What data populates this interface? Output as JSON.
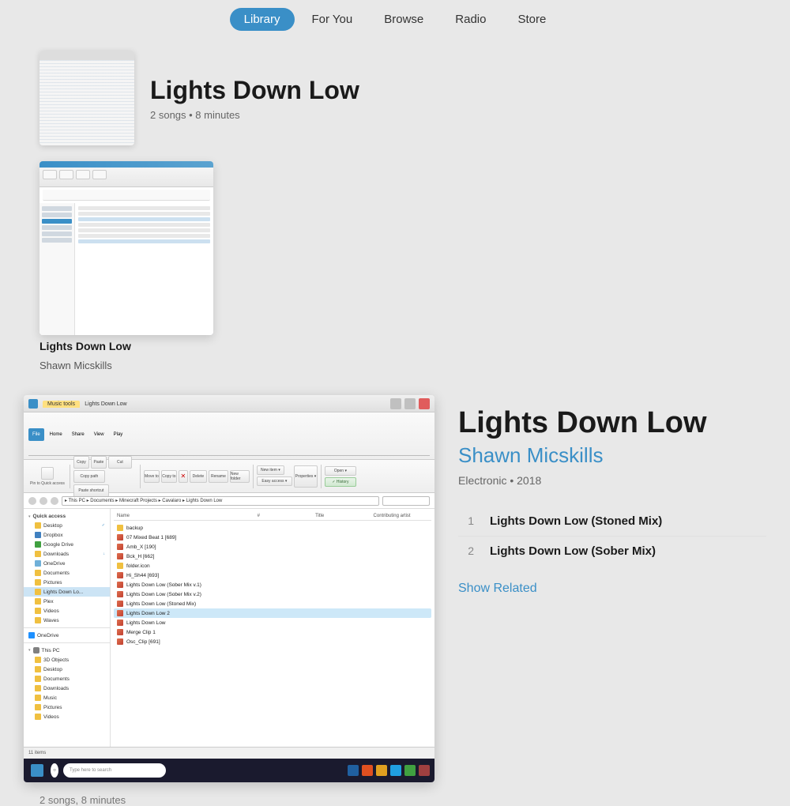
{
  "nav": {
    "items": [
      "Library",
      "For You",
      "Browse",
      "Radio",
      "Store"
    ],
    "active": "Library"
  },
  "hero": {
    "title": "Lights Down Low",
    "songs_count": "2 songs",
    "duration": "8 minutes",
    "meta": "2 songs • 8 minutes"
  },
  "album_card": {
    "name": "Lights Down Low",
    "artist": "Shawn Micskills"
  },
  "right_panel": {
    "title": "Lights Down Low",
    "artist": "Shawn Micskills",
    "genre": "Electronic",
    "year": "2018",
    "genre_year": "Electronic • 2018",
    "tracks": [
      {
        "num": "1",
        "name": "Lights Down Low (Stoned Mix)"
      },
      {
        "num": "2",
        "name": "Lights Down Low (Sober Mix)"
      }
    ],
    "show_related": "Show Related"
  },
  "explorer": {
    "tabs": [
      "File",
      "Home",
      "Share",
      "View",
      "Play"
    ],
    "music_tools_tab": "Music tools",
    "title_tab": "Lights Down Low",
    "address": "This PC › Documents › Minecraft Projects › Cavalaro › Lights Down Low",
    "tree": [
      {
        "label": "Quick access",
        "type": "header"
      },
      {
        "label": "Desktop",
        "type": "folder",
        "indent": 1
      },
      {
        "label": "Dropbox",
        "type": "folder-blue",
        "indent": 1
      },
      {
        "label": "Google Drive",
        "type": "folder-green",
        "indent": 1
      },
      {
        "label": "Downloads",
        "type": "folder",
        "indent": 1
      },
      {
        "label": "OneDrive",
        "type": "cloud",
        "indent": 1
      },
      {
        "label": "Documents",
        "type": "folder",
        "indent": 1
      },
      {
        "label": "Pictures",
        "type": "folder",
        "indent": 1
      },
      {
        "label": "Lights Down Lo...",
        "type": "folder",
        "indent": 1,
        "selected": true
      },
      {
        "label": "Plex",
        "type": "folder",
        "indent": 1
      },
      {
        "label": "Videos",
        "type": "folder",
        "indent": 1
      },
      {
        "label": "Waves",
        "type": "folder",
        "indent": 1
      },
      {
        "label": "OneDrive",
        "type": "onedrive",
        "indent": 0
      },
      {
        "label": "This PC",
        "type": "pc",
        "indent": 0
      },
      {
        "label": "3D Objects",
        "type": "folder",
        "indent": 1
      },
      {
        "label": "Desktop",
        "type": "folder",
        "indent": 1
      },
      {
        "label": "Documents",
        "type": "folder",
        "indent": 1
      },
      {
        "label": "Downloads",
        "type": "folder",
        "indent": 1
      },
      {
        "label": "Music",
        "type": "folder",
        "indent": 1
      },
      {
        "label": "Pictures",
        "type": "folder",
        "indent": 1
      },
      {
        "label": "Videos",
        "type": "folder",
        "indent": 1
      }
    ],
    "files_header": [
      "Name",
      "#",
      "Title",
      "Contributing artist"
    ],
    "files": [
      {
        "name": "backup",
        "type": "folder"
      },
      {
        "name": "07 Mixed Beat 1 [689]",
        "type": "audio"
      },
      {
        "name": "Amb_X [190]",
        "type": "audio"
      },
      {
        "name": "Bck_H [662]",
        "type": "audio"
      },
      {
        "name": "folder.icon",
        "type": "folder"
      },
      {
        "name": "Hi_Sh44 [693]",
        "type": "audio"
      },
      {
        "name": "Lights Down Low (Sober Mix v.1)",
        "type": "audio"
      },
      {
        "name": "Lights Down Low (Sober Mix v.2)",
        "type": "audio"
      },
      {
        "name": "Lights Down Low (Stoned Mix)",
        "type": "audio"
      },
      {
        "name": "Lights Down Low 2",
        "type": "audio",
        "selected": true
      },
      {
        "name": "Lights Down Low",
        "type": "audio"
      },
      {
        "name": "Merge Clip 1",
        "type": "audio"
      },
      {
        "name": "Osc_Clip [691]",
        "type": "audio"
      }
    ],
    "status": "11 items",
    "taskbar_search": "Type here to search"
  },
  "footer": {
    "text": "2 songs, 8 minutes"
  }
}
